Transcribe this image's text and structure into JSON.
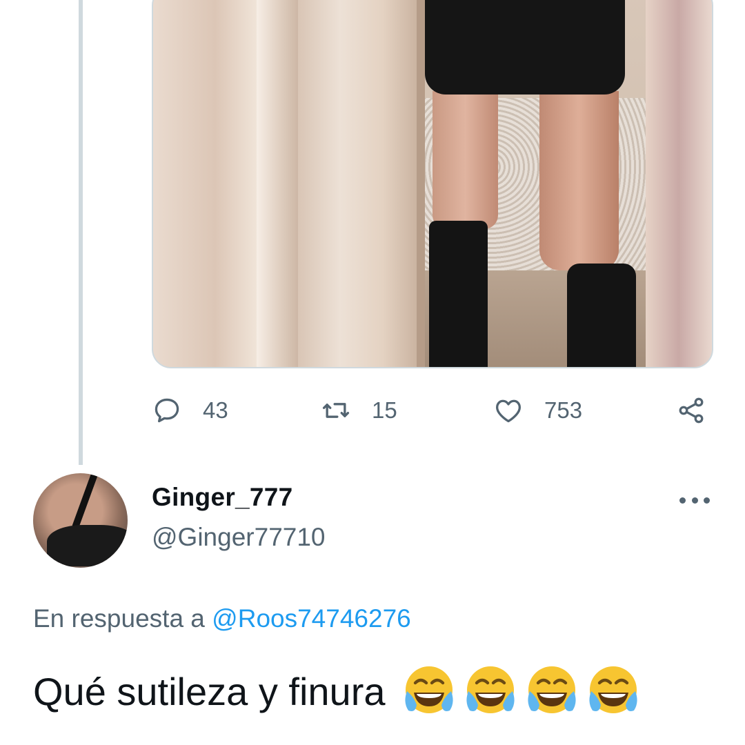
{
  "tweet": {
    "stats": {
      "replies": "43",
      "retweets": "15",
      "likes": "753"
    }
  },
  "reply": {
    "display_name": "Ginger_777",
    "handle": "@Ginger77710",
    "in_reply_to_prefix": "En respuesta a",
    "in_reply_to_mention": "@Roos74746276",
    "text": "Qué sutileza y finura",
    "emojis": [
      "face-with-tears-of-joy",
      "face-with-tears-of-joy",
      "face-with-tears-of-joy",
      "face-with-tears-of-joy"
    ]
  },
  "colors": {
    "secondary_text": "#536471",
    "link": "#1d9bf0",
    "thread_line": "#cfd9de",
    "primary_text": "#0f1419"
  },
  "icons": [
    "reply-icon",
    "retweet-icon",
    "like-icon",
    "share-icon",
    "more-icon"
  ]
}
